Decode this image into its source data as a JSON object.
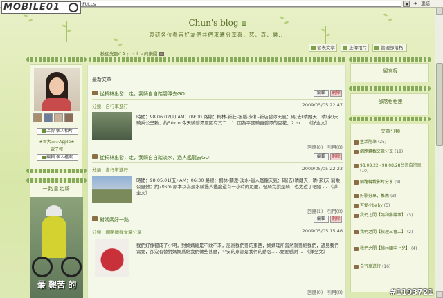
{
  "browser": {
    "address_label": "網址",
    "url": "...6fdRmYMeWeER55HVMV3rFULLs",
    "links_label": "連結"
  },
  "logo_text": "MOBILE01",
  "header": {
    "blog_title": "Chun's blog",
    "subtitle": "衷研各位看吉好友們共們來遭分享喜、怒、哀、樂...",
    "buttons": [
      "發表文章",
      "上傳相片",
      "管理部落格"
    ]
  },
  "welcome": "歡迎光臨CＡｐｐｌｅ的樂園",
  "profile": {
    "upload_label": "上傳 個人相片",
    "apple_label": "★君大王☆Apple★",
    "friend_label": "電子報",
    "edit_label": "編輯 個人檔案"
  },
  "left_box2": {
    "title": "一路靠北騎",
    "caption": "最 艱苦 的"
  },
  "main": {
    "heading": "最新文章",
    "edit_label": "編輯",
    "delete_label": "刪除",
    "posts": [
      {
        "title": "從桐林出發，走，我騎自自踏碧潭去GO!",
        "category": "分類：自行車進行",
        "date": "2009/05/05 22:47",
        "body": "時間：98.06.02(T) AM：09:00 路線：桐林-新莊-板橋-永和-新店碧潭天風：碼(去)晴朗天，晴(來)天 騎乘公里數：約50km 今天騎碧潭原因有其二：1. 因為平國騎自碧潭的豆花，2.m ... 《詳全文》",
        "footer": "回應(0) | 引用(0)"
      },
      {
        "title": "從桐林出發，走，我騎自自踏淡水，過人鑑龍去GO!",
        "category": "分類：自行車進行",
        "date": "2009/05/05 22:23",
        "body": "時間：98.05.01(五) AM：06:30 路線：桐林-關渡-淡水-過人鑑龍天氣：碼(去)晴朗天，晴(來)天 騎乘公里數：約70km 原本以為淡水騎過人鑑龍還有一小時的距離，但騎完說是騎，也太近了吧給 ... 《詳全文》",
        "footer": "回應(1) | 引用(0)"
      },
      {
        "title": "對媽媽好一點",
        "category": "分類：網路轉載文章分享",
        "date": "2009/05/05 15:46",
        "body": "我們好像都成了小明，對媽媽總是不敢不求，認爲我們要的東西，媽媽理所當然就要給我們，遇見我們需要，卻沒有替對媽媽爲給我們做些甚麼，平安的來源是我們的動容......要要感謝 ... 《詳全文》",
        "footer": "回應(0) | 引用(0)"
      }
    ]
  },
  "right": {
    "guestbook": "留言板",
    "blog_list": "部落格格連",
    "categories_title": "文章分類",
    "categories": [
      {
        "label": "生活隨筆",
        "count": "(25)"
      },
      {
        "label": "網路轉載文章分享",
        "count": "(19)"
      },
      {
        "label": "98.08.22~98.08.28台灣自行車",
        "count": "(10)"
      },
      {
        "label": "網路轉載影片分享",
        "count": "(9)"
      },
      {
        "label": "好歌分享，推薦",
        "count": "(3)"
      },
      {
        "label": "可愛小baby",
        "count": "(5)"
      },
      {
        "label": "我們之間【臨和雞議事】",
        "count": "(3)"
      },
      {
        "label": "我們之間【敘理三會二】",
        "count": "(2)"
      },
      {
        "label": "我們之間【桃林國中七兒】",
        "count": "(4)"
      },
      {
        "label": "自行車進行",
        "count": "(16)"
      }
    ]
  },
  "watermark": "#1193721"
}
